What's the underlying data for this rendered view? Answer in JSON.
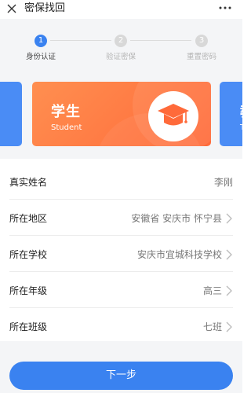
{
  "header": {
    "title": "密保找回",
    "close_icon": "close-icon",
    "more_icon": "more-dots-icon"
  },
  "steps": [
    {
      "number": "1",
      "label": "身份认证",
      "active": true
    },
    {
      "number": "2",
      "label": "验证密保",
      "active": false
    },
    {
      "number": "3",
      "label": "重置密码",
      "active": false
    }
  ],
  "cards": {
    "center": {
      "title": "学生",
      "subtitle": "Student",
      "icon": "graduation-cap-icon"
    },
    "right": {
      "title": "教",
      "subtitle": "T"
    }
  },
  "form": {
    "rows": [
      {
        "label": "真实姓名",
        "value": "李刚"
      },
      {
        "label": "所在地区",
        "value": "安徽省 安庆市 怀宁县"
      },
      {
        "label": "所在学校",
        "value": "安庆市宜城科技学校"
      },
      {
        "label": "所在年级",
        "value": "高三"
      },
      {
        "label": "所在班级",
        "value": "七班"
      }
    ]
  },
  "footer": {
    "next_label": "下一步"
  },
  "colors": {
    "primary": "#3a82f0",
    "student_card": "#ff7443",
    "side_card": "#4a8cf5",
    "background": "#f4f5f7"
  }
}
